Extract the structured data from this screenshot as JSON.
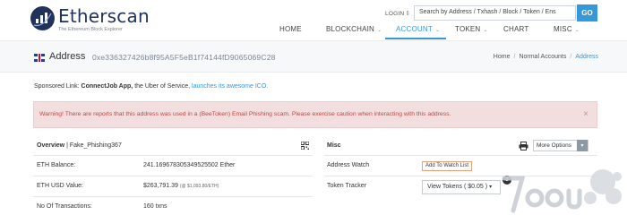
{
  "header": {
    "logo_name": "Etherscan",
    "logo_tagline": "The Ethereum Block Explorer",
    "login_label": "LOGIN",
    "search_placeholder": "Search by Address / Txhash / Block / Token / Ens",
    "go_label": "GO",
    "brand_color": "#21325b",
    "accent_color": "#3498db"
  },
  "nav": {
    "items": [
      {
        "label": "HOME",
        "has_caret": false
      },
      {
        "label": "BLOCKCHAIN",
        "has_caret": true
      },
      {
        "label": "ACCOUNT",
        "has_caret": true,
        "active": true
      },
      {
        "label": "TOKEN",
        "has_caret": true
      },
      {
        "label": "CHART",
        "has_caret": false
      },
      {
        "label": "MISC",
        "has_caret": true
      }
    ]
  },
  "page": {
    "title": "Address",
    "address": "0xe336327426b8f95A5F5eB1f74144fD9065069C28",
    "breadcrumb": [
      "Home",
      "Normal Accounts",
      "Address"
    ]
  },
  "sponsored": {
    "prefix": "Sponsored Link:",
    "name": "ConnectJob App,",
    "middle": "the Uber of Service,",
    "link": "launches its awesome ICO."
  },
  "alert": {
    "text": "Warning! There are reports that this address was used in a (BeeToken) Email Phishing scam. Please exercise caution when interacting with this address.",
    "close": "×"
  },
  "overview": {
    "title": "Overview",
    "tag": "| Fake_Phishing367",
    "rows": [
      {
        "label": "ETH Balance:",
        "value": "241.169678305349525502 Ether",
        "note": ""
      },
      {
        "label": "ETH USD Value:",
        "value": "$263,791.39",
        "note": "(@ $1,093.80/ETH)"
      },
      {
        "label": "No Of Transactions:",
        "value": "160 txns",
        "note": ""
      }
    ]
  },
  "misc": {
    "title": "Misc",
    "more_options_label": "More Options",
    "address_watch_label": "Address Watch",
    "watch_button": "Add To Watch List",
    "token_tracker_label": "Token Tracker",
    "tokens_button": "View Tokens ( $0.05 )",
    "tokens_badge": "3"
  }
}
